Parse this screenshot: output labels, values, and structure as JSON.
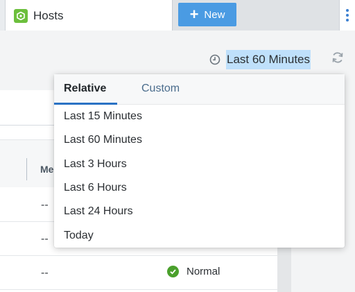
{
  "tabs": {
    "active_label": "Hosts",
    "new_button_label": "New",
    "new_button_icon": "plus-icon"
  },
  "controls": {
    "time_range_value": "Last 60 Minutes",
    "clock_icon": "clock-icon",
    "refresh_icon": "refresh-icon"
  },
  "table": {
    "column_header": "Me",
    "rows": [
      {
        "value": "--",
        "status": ""
      },
      {
        "value": "--",
        "status": ""
      },
      {
        "value": "--",
        "status": "Normal"
      }
    ]
  },
  "dropdown": {
    "tabs": [
      "Relative",
      "Custom"
    ],
    "selected_tab": "Relative",
    "items": [
      "Last 15 Minutes",
      "Last 60 Minutes",
      "Last 3 Hours",
      "Last 6 Hours",
      "Last 24 Hours",
      "Today"
    ]
  },
  "colors": {
    "accent": "#2a72c4",
    "new_button": "#4a9be3",
    "selection_highlight": "#bfe0fb",
    "status_ok": "#4aa02c",
    "hosts_icon": "#6cbf3c"
  }
}
